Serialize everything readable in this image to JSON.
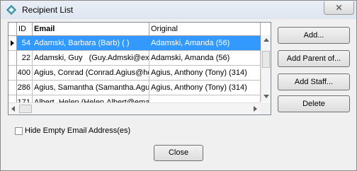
{
  "window": {
    "title": "Recipient List",
    "close_glyph": "✕",
    "icon": "diamond-app-icon"
  },
  "grid": {
    "columns": [
      "ID",
      "Email",
      "Original"
    ],
    "rows": [
      {
        "id": "54",
        "email": "Adamski, Barbara (Barb) ( )",
        "original": "Adamski, Amanda (56)",
        "selected": true
      },
      {
        "id": "22",
        "email": "Adamski, Guy   (Guy.Admski@exa",
        "original": "Adamski, Amanda (56)",
        "selected": false
      },
      {
        "id": "400",
        "email": "Agius, Conrad (Conrad.Agius@ho",
        "original": "Agius, Anthony (Tony) (314)",
        "selected": false
      },
      {
        "id": "286",
        "email": "Agius, Samantha (Samantha.Agui",
        "original": "Agius, Anthony (Tony) (314)",
        "selected": false
      },
      {
        "id": "171",
        "email": "Albert, Helen (Helen.Albert@email",
        "original": "",
        "selected": false
      }
    ],
    "selection_color": "#3399ff"
  },
  "buttons": {
    "add": "Add...",
    "add_parent": "Add Parent of...",
    "add_staff": "Add Staff...",
    "delete": "Delete",
    "close": "Close"
  },
  "options": {
    "hide_empty_label": "Hide Empty Email Address(es)",
    "hide_empty_checked": false
  }
}
